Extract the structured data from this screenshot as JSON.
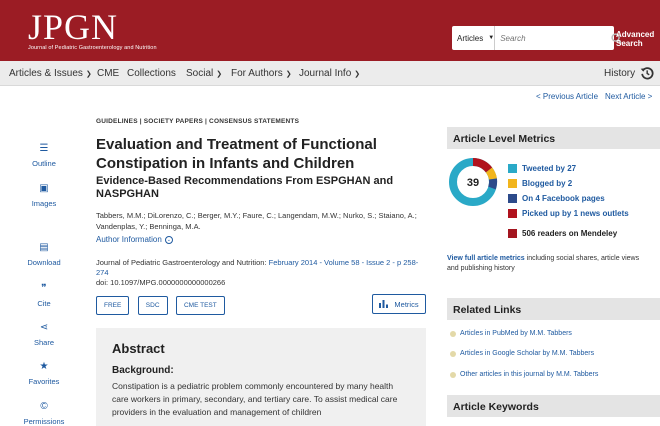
{
  "header": {
    "logo": "JPGN",
    "logo_sub": "Journal of Pediatric Gastroenterology and Nutrition",
    "search_scope": "Articles",
    "search_placeholder": "Search",
    "advanced_search_1": "Advanced",
    "advanced_search_2": "Search"
  },
  "nav": {
    "articles_issues": "Articles & Issues",
    "cme": "CME",
    "collections": "Collections",
    "social": "Social",
    "for_authors": "For Authors",
    "journal_info": "Journal Info",
    "history": "History"
  },
  "article_nav": {
    "prev": "< Previous Article",
    "next": "Next Article >"
  },
  "sidebar": {
    "outline": "Outline",
    "images": "Images",
    "download": "Download",
    "cite": "Cite",
    "share": "Share",
    "favorites": "Favorites",
    "permissions": "Permissions"
  },
  "article": {
    "breadcrumb": "GUIDELINES | SOCIETY PAPERS | CONSENSUS STATEMENTS",
    "title": "Evaluation and Treatment of Functional Constipation in Infants and Children",
    "subtitle": "Evidence-Based Recommendations From ESPGHAN and NASPGHAN",
    "authors": "Tabbers, M.M.; DiLorenzo, C.; Berger, M.Y.; Faure, C.; Langendam, M.W.; Nurko, S.; Staiano, A.; Vandenplas, Y.; Benninga, M.A.",
    "author_info": "Author Information",
    "journal": "Journal of Pediatric Gastroenterology and Nutrition:",
    "issue_link": "February 2014 - Volume 58 - Issue 2 - p 258-274",
    "doi": "doi: 10.1097/MPG.0000000000000266",
    "tags": [
      "FREE",
      "SDC",
      "CME TEST"
    ],
    "metrics_label": "Metrics"
  },
  "abstract": {
    "heading": "Abstract",
    "background_heading": "Background:",
    "text": "Constipation is a pediatric problem commonly encountered by many health care workers in primary, secondary, and tertiary care. To assist medical care providers in the evaluation and management of children"
  },
  "metrics": {
    "heading": "Article Level Metrics",
    "score": "39",
    "tweeted": "Tweeted by 27",
    "blogged": "Blogged by 2",
    "facebook": "On 4 Facebook pages",
    "news": "Picked up by 1 news outlets",
    "mendeley": "506 readers on Mendeley",
    "view_full": "View full article metrics",
    "view_full_rest": " including social shares, article views and publishing history",
    "colors": {
      "tweeted": "#2aa9c7",
      "blogged": "#f2b51c",
      "facebook": "#2c4a8a",
      "news": "#b0121d",
      "mendeley": "#a3151f"
    }
  },
  "related": {
    "heading": "Related Links",
    "items": [
      "Articles in PubMed by M.M. Tabbers",
      "Articles in Google Scholar by M.M. Tabbers",
      "Other articles in this journal by M.M. Tabbers"
    ]
  },
  "keywords": {
    "heading": "Article Keywords"
  }
}
